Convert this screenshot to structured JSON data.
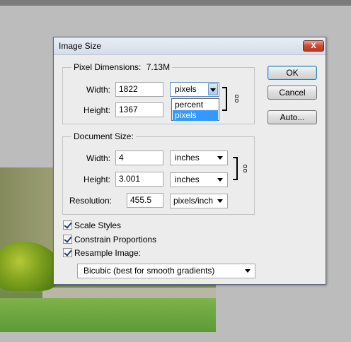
{
  "dialog": {
    "title": "Image Size",
    "close_label": "X"
  },
  "pixel_dimensions": {
    "legend": "Pixel Dimensions:",
    "size": "7.13M",
    "width_label": "Width:",
    "width_value": "1822",
    "width_unit": "pixels",
    "height_label": "Height:",
    "height_value": "1367",
    "unit_options": [
      "percent",
      "pixels"
    ],
    "unit_selected": "pixels"
  },
  "document_size": {
    "legend": "Document Size:",
    "width_label": "Width:",
    "width_value": "4",
    "width_unit": "inches",
    "height_label": "Height:",
    "height_value": "3.001",
    "height_unit": "inches",
    "resolution_label": "Resolution:",
    "resolution_value": "455.5",
    "resolution_unit": "pixels/inch"
  },
  "buttons": {
    "ok": "OK",
    "cancel": "Cancel",
    "auto": "Auto..."
  },
  "options": {
    "scale_styles": {
      "label": "Scale Styles",
      "checked": true
    },
    "constrain_proportions": {
      "label": "Constrain Proportions",
      "checked": true
    },
    "resample_image": {
      "label": "Resample Image:",
      "checked": true
    },
    "resample_method": "Bicubic (best for smooth gradients)"
  },
  "icons": {
    "link_icon": "chain-link-icon",
    "dropdown_arrow": "chevron-down-icon"
  }
}
